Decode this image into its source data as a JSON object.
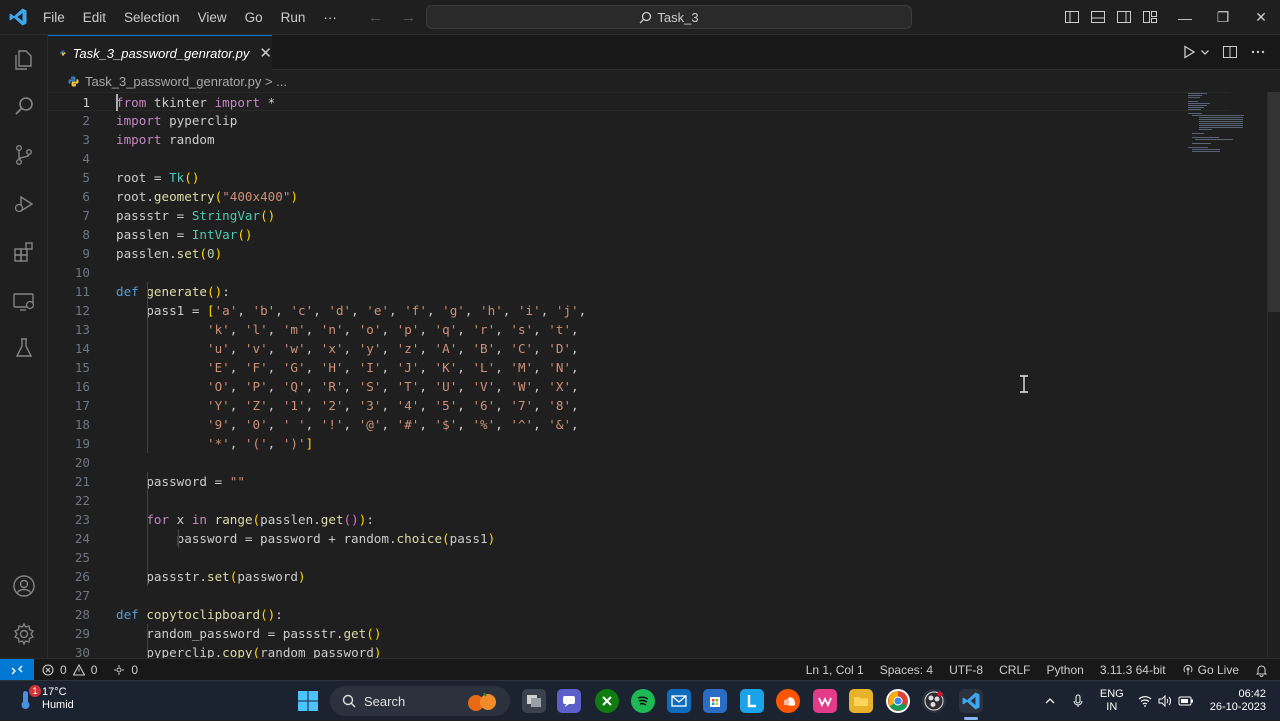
{
  "window": {
    "menu": [
      "File",
      "Edit",
      "Selection",
      "View",
      "Go",
      "Run",
      "···"
    ],
    "command_center": "Task_3",
    "nav_back": "←",
    "nav_forward": "→",
    "minimize": "—",
    "restore": "❐",
    "close": "✕"
  },
  "activity_bar": [
    "explorer-icon",
    "search-icon",
    "source-control-icon",
    "run-debug-icon",
    "extensions-icon",
    "remote-explorer-icon",
    "testing-icon",
    "account-icon",
    "settings-gear-icon"
  ],
  "tab": {
    "label": "Task_3_password_genrator.py",
    "close": "✕"
  },
  "breadcrumb": {
    "file": "Task_3_password_genrator.py",
    "sep": " > ",
    "more": "..."
  },
  "editor": {
    "line_numbers": [
      "1",
      "2",
      "3",
      "4",
      "5",
      "6",
      "7",
      "8",
      "9",
      "10",
      "11",
      "12",
      "13",
      "14",
      "15",
      "16",
      "17",
      "18",
      "19",
      "20",
      "21",
      "22",
      "23",
      "24",
      "25",
      "26",
      "27",
      "28",
      "29",
      "30"
    ],
    "lines": [
      "from tkinter import *",
      "import pyperclip",
      "import random",
      "",
      "root = Tk()",
      "root.geometry(\"400x400\")",
      "passstr = StringVar()",
      "passlen = IntVar()",
      "passlen.set(0)",
      "",
      "def generate():",
      "    pass1 = ['a', 'b', 'c', 'd', 'e', 'f', 'g', 'h', 'i', 'j',",
      "            'k', 'l', 'm', 'n', 'o', 'p', 'q', 'r', 's', 't',",
      "            'u', 'v', 'w', 'x', 'y', 'z', 'A', 'B', 'C', 'D',",
      "            'E', 'F', 'G', 'H', 'I', 'J', 'K', 'L', 'M', 'N',",
      "            'O', 'P', 'Q', 'R', 'S', 'T', 'U', 'V', 'W', 'X',",
      "            'Y', 'Z', '1', '2', '3', '4', '5', '6', '7', '8',",
      "            '9', '0', ' ', '!', '@', '#', '$', '%', '^', '&',",
      "            '*', '(', ')']",
      "",
      "    password = \"\"",
      "",
      "    for x in range(passlen.get()):",
      "        password = password + random.choice(pass1)",
      "",
      "    passstr.set(password)",
      "",
      "def copytoclipboard():",
      "    random_password = passstr.get()",
      "    pyperclip.copy(random_password)"
    ]
  },
  "status_bar": {
    "errors": "0",
    "warnings": "0",
    "ports": "0",
    "position": "Ln 1, Col 1",
    "spaces": "Spaces: 4",
    "encoding": "UTF-8",
    "eol": "CRLF",
    "language": "Python",
    "interpreter": "3.11.3 64-bit",
    "live": "Go Live"
  },
  "taskbar": {
    "temperature": "17°C",
    "weather": "Humid",
    "weather_badge": "1",
    "search": "Search",
    "lang": "ENG",
    "region": "IN",
    "time": "06:42",
    "date": "26-10-2023"
  },
  "colors": {
    "accent": "#0078d4",
    "keyword": "#569cd6",
    "import_keyword": "#c586c0",
    "function": "#dcdcaa",
    "string": "#ce9178",
    "number": "#b5cea8"
  }
}
